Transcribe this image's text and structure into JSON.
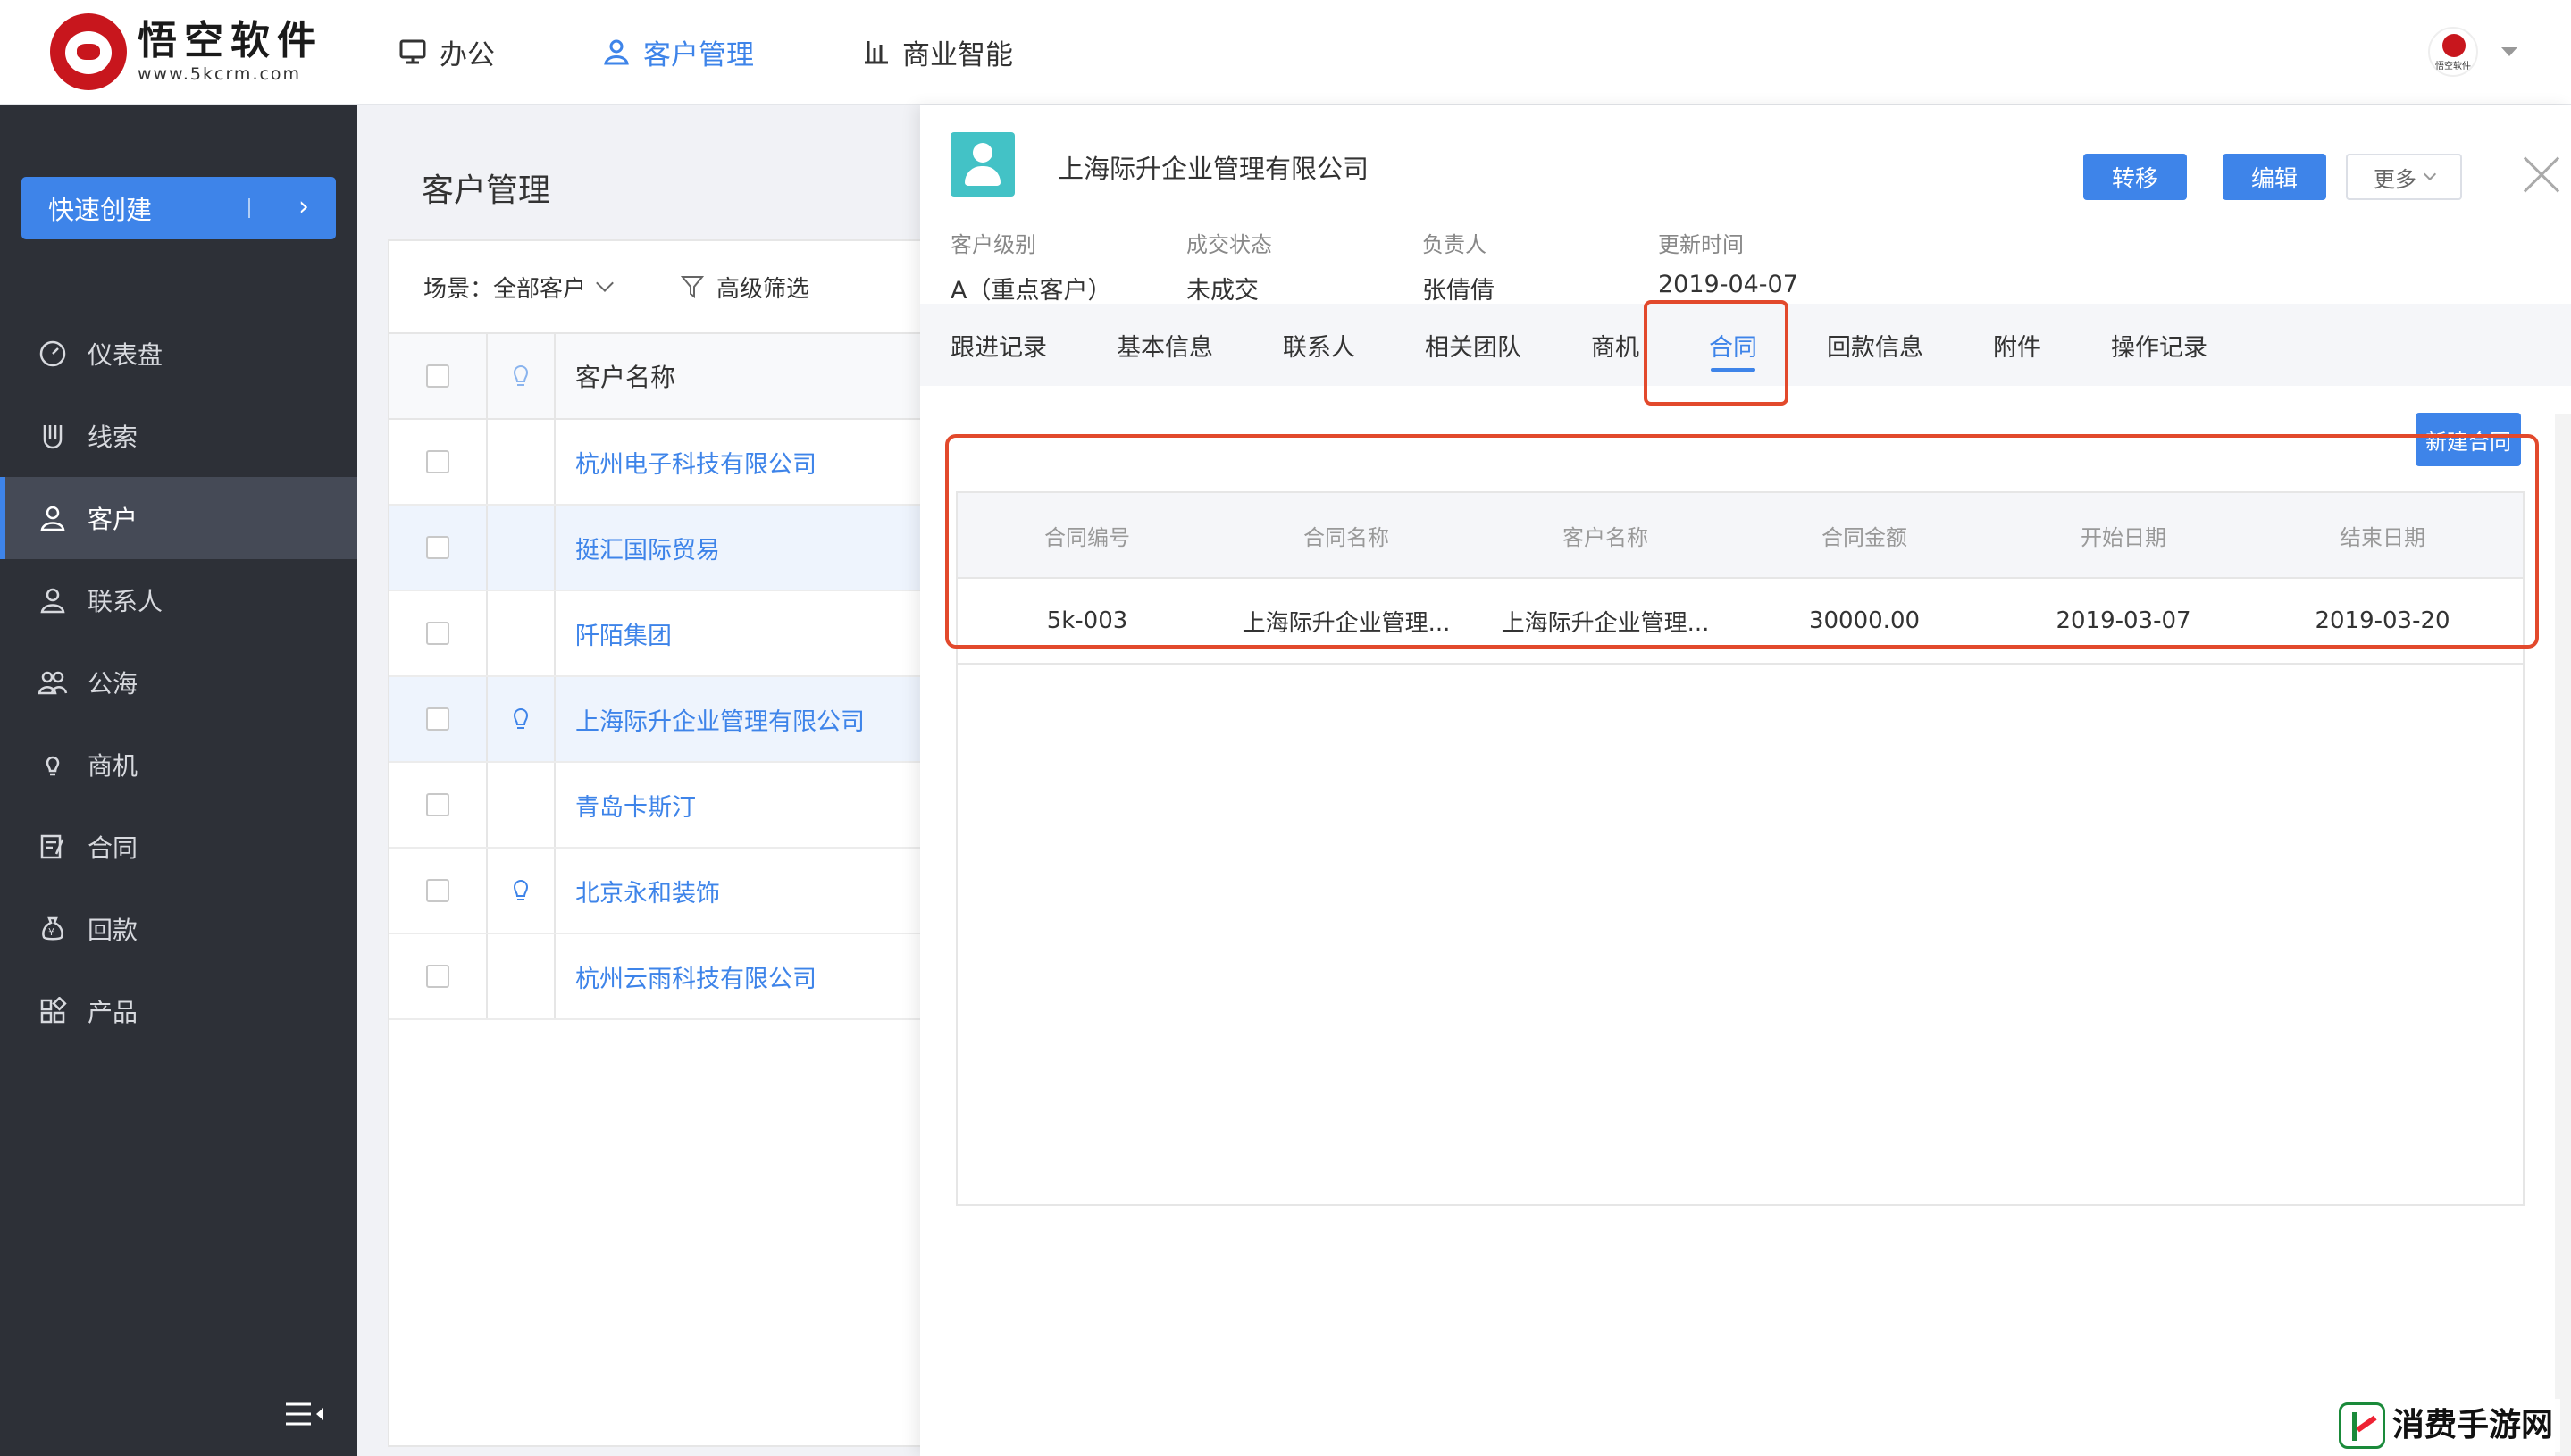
{
  "header": {
    "logo_title": "悟空软件",
    "logo_url": "www.5kcrm.com",
    "nav": [
      {
        "label": "办公",
        "icon": "monitor-icon",
        "active": false
      },
      {
        "label": "客户管理",
        "icon": "user-icon",
        "active": true
      },
      {
        "label": "商业智能",
        "icon": "bar-chart-icon",
        "active": false
      }
    ],
    "avatar_text": "悟空软件"
  },
  "sidebar": {
    "quick_create": "快速创建",
    "items": [
      {
        "label": "仪表盘",
        "icon": "dashboard-icon"
      },
      {
        "label": "线索",
        "icon": "magnet-icon"
      },
      {
        "label": "客户",
        "icon": "customer-icon",
        "active": true
      },
      {
        "label": "联系人",
        "icon": "contact-icon"
      },
      {
        "label": "公海",
        "icon": "group-icon"
      },
      {
        "label": "商机",
        "icon": "bulb-icon"
      },
      {
        "label": "合同",
        "icon": "contract-icon"
      },
      {
        "label": "回款",
        "icon": "money-bag-icon"
      },
      {
        "label": "产品",
        "icon": "product-grid-icon"
      }
    ]
  },
  "main": {
    "page_title": "客户管理",
    "filter": {
      "scene": "场景：全部客户",
      "advanced": "高级筛选"
    },
    "list": {
      "column_name": "客户名称",
      "rows": [
        {
          "name": "杭州电子科技有限公司",
          "bulb": false,
          "highlight": false
        },
        {
          "name": "挺汇国际贸易",
          "bulb": false,
          "highlight": true
        },
        {
          "name": "阡陌集团",
          "bulb": false,
          "highlight": false
        },
        {
          "name": "上海际升企业管理有限公司",
          "bulb": true,
          "highlight": true
        },
        {
          "name": "青岛卡斯汀",
          "bulb": false,
          "highlight": false
        },
        {
          "name": "北京永和装饰",
          "bulb": true,
          "highlight": false
        },
        {
          "name": "杭州云雨科技有限公司",
          "bulb": false,
          "highlight": false
        }
      ]
    }
  },
  "drawer": {
    "customer_name": "上海际升企业管理有限公司",
    "buttons": {
      "transfer": "转移",
      "edit": "编辑",
      "more": "更多"
    },
    "meta": [
      {
        "label": "客户级别",
        "value": "A（重点客户）"
      },
      {
        "label": "成交状态",
        "value": "未成交"
      },
      {
        "label": "负责人",
        "value": "张倩倩"
      },
      {
        "label": "更新时间",
        "value": "2019-04-07"
      }
    ],
    "tabs": [
      {
        "label": "跟进记录",
        "active": false
      },
      {
        "label": "基本信息",
        "active": false
      },
      {
        "label": "联系人",
        "active": false
      },
      {
        "label": "相关团队",
        "active": false
      },
      {
        "label": "商机",
        "active": false
      },
      {
        "label": "合同",
        "active": true
      },
      {
        "label": "回款信息",
        "active": false
      },
      {
        "label": "附件",
        "active": false
      },
      {
        "label": "操作记录",
        "active": false
      }
    ],
    "new_contract": "新建合同",
    "contract_table": {
      "columns": [
        "合同编号",
        "合同名称",
        "客户名称",
        "合同金额",
        "开始日期",
        "结束日期"
      ],
      "rows": [
        [
          "5k-003",
          "上海际升企业管理...",
          "上海际升企业管理...",
          "30000.00",
          "2019-03-07",
          "2019-03-20"
        ]
      ]
    }
  },
  "watermark": "消费手游网",
  "colors": {
    "accent": "#3e84e9",
    "sidebar_bg": "#2d3037",
    "highlight_box": "#e2492c",
    "avatar_teal": "#43c2c6"
  }
}
